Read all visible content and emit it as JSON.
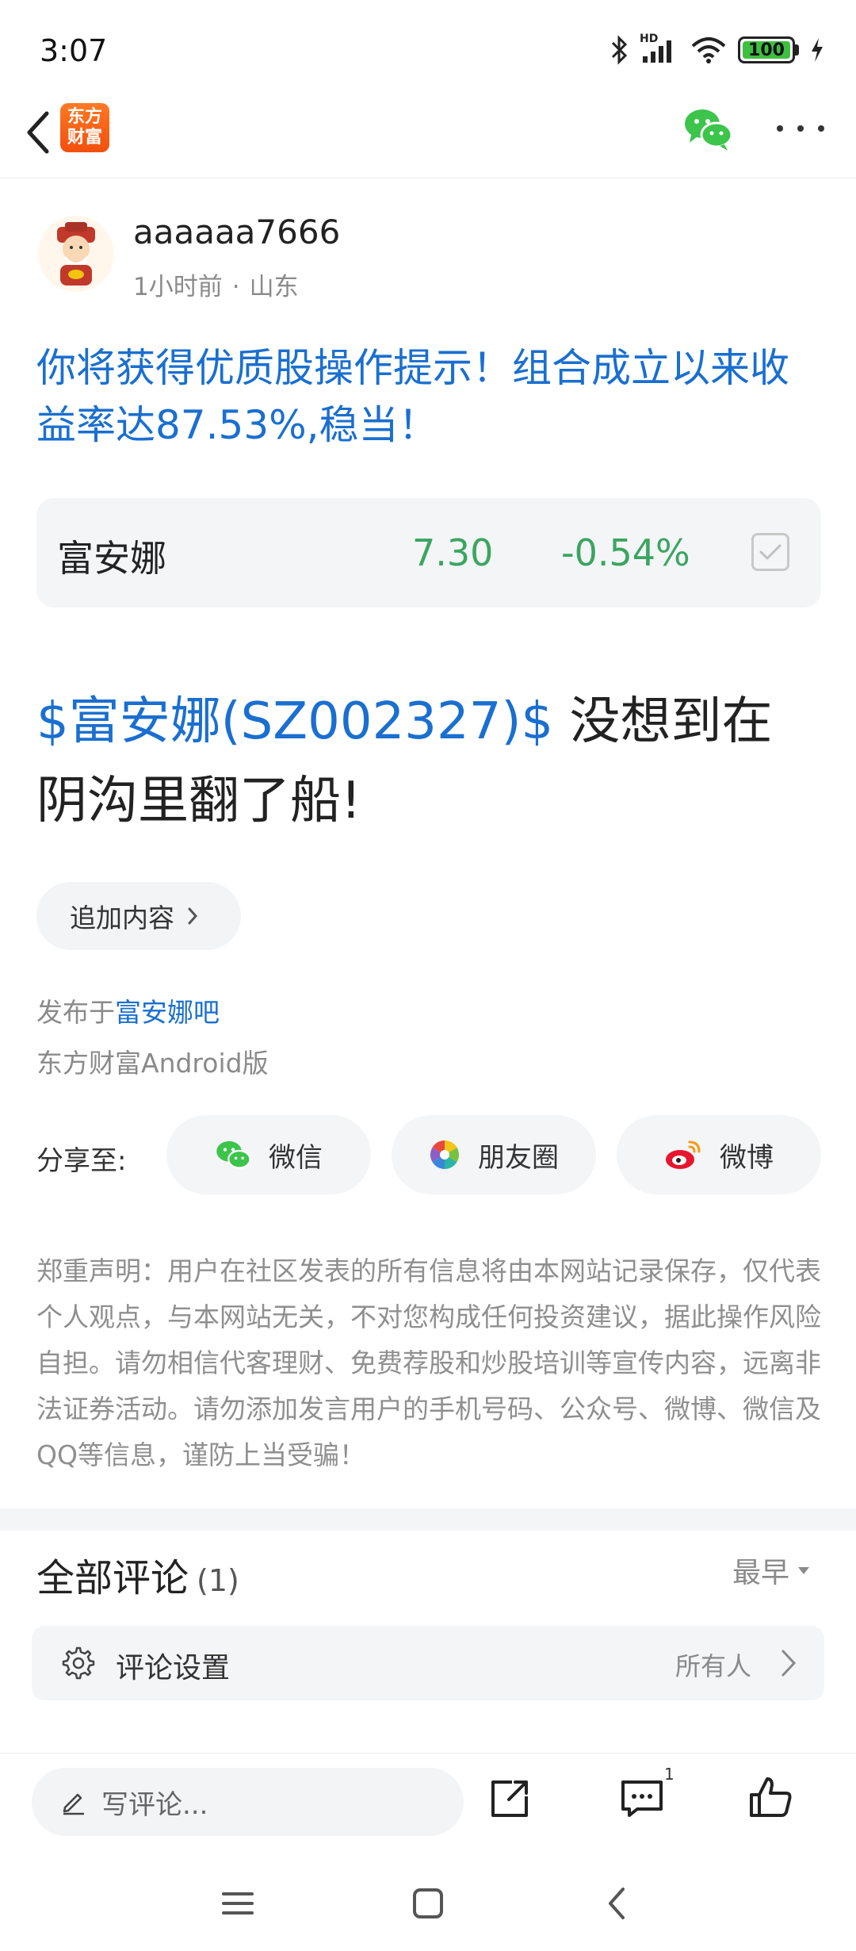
{
  "status_bar": {
    "time": "3:07",
    "network_label": "HD",
    "battery": "100"
  },
  "app": {
    "logo_text": "东方\n财富"
  },
  "post": {
    "username": "aaaaaa7666",
    "time_ago": "1小时前",
    "separator": "·",
    "location": "山东",
    "promo_text": "你将获得优质股操作提示！组合成立以来收益率达87.53%,稳当！",
    "stock_card": {
      "name": "富安娜",
      "price": "7.30",
      "change": "-0.54%"
    },
    "body_stock_link": "$富安娜(SZ002327)$",
    "body_text": " 没想到在阴沟里翻了船!",
    "add_content_label": "追加内容",
    "published_prefix": "发布于",
    "published_forum": "富安娜吧",
    "client": "东方财富Android版"
  },
  "share": {
    "label": "分享至:",
    "wechat": "微信",
    "moments": "朋友圈",
    "weibo": "微博"
  },
  "disclaimer": "郑重声明：用户在社区发表的所有信息将由本网站记录保存，仅代表个人观点，与本网站无关，不对您构成任何投资建议，据此操作风险自担。请勿相信代客理财、免费荐股和炒股培训等宣传内容，远离非法证券活动。请勿添加发言用户的手机号码、公众号、微博、微信及QQ等信息，谨防上当受骗！",
  "comments": {
    "title": "全部评论",
    "count": "(1)",
    "sort": "最早",
    "settings_label": "评论设置",
    "settings_value": "所有人"
  },
  "bottom_bar": {
    "input_placeholder": "写评论...",
    "comment_badge": "1"
  },
  "colors": {
    "accent_blue": "#1a6fd0",
    "stock_green": "#3aa561",
    "brand_orange": "#f2601a",
    "wechat_green": "#3cc44b"
  }
}
